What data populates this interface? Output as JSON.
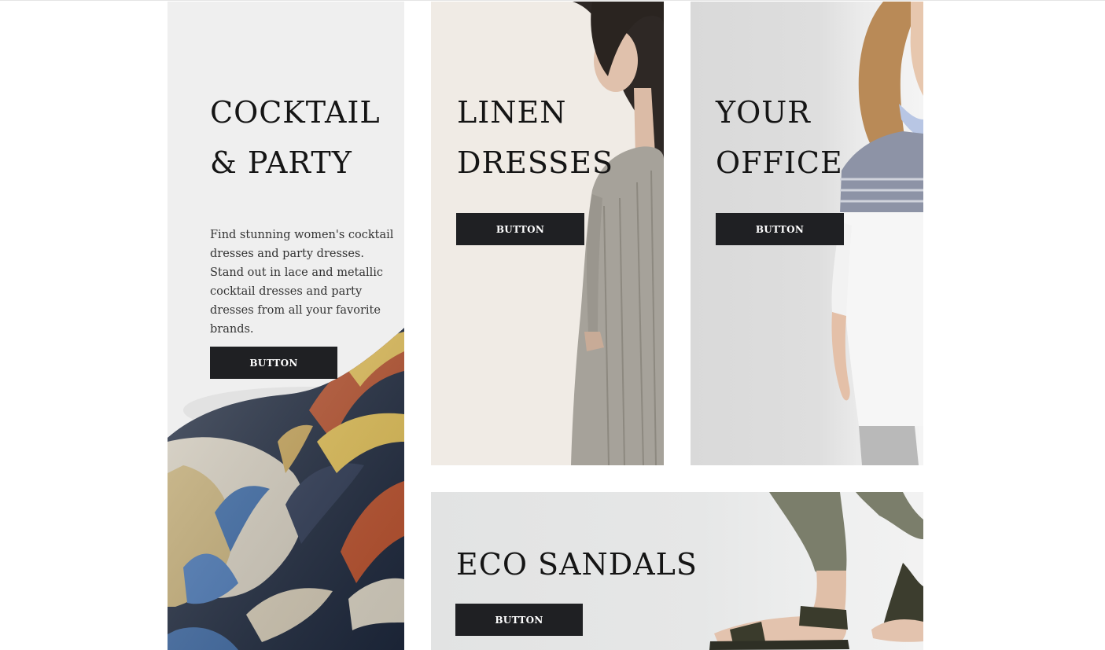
{
  "cards": {
    "cocktail": {
      "title_line1": "COCKTAIL",
      "title_line2": "& PARTY",
      "description": "Find stunning women's cocktail dresses and party dresses. Stand out in lace and metallic cocktail dresses and party dresses from all your favorite brands.",
      "button_label": "BUTTON"
    },
    "linen": {
      "title_line1": "LINEN",
      "title_line2": "DRESSES",
      "button_label": "BUTTON"
    },
    "office": {
      "title_line1": "YOUR",
      "title_line2": "OFFICE",
      "button_label": "BUTTON"
    },
    "eco": {
      "title": "ECO SANDALS",
      "button_label": "BUTTON"
    }
  },
  "colors": {
    "button_bg": "#1f2023",
    "button_text": "#ffffff",
    "title_text": "#151515"
  }
}
